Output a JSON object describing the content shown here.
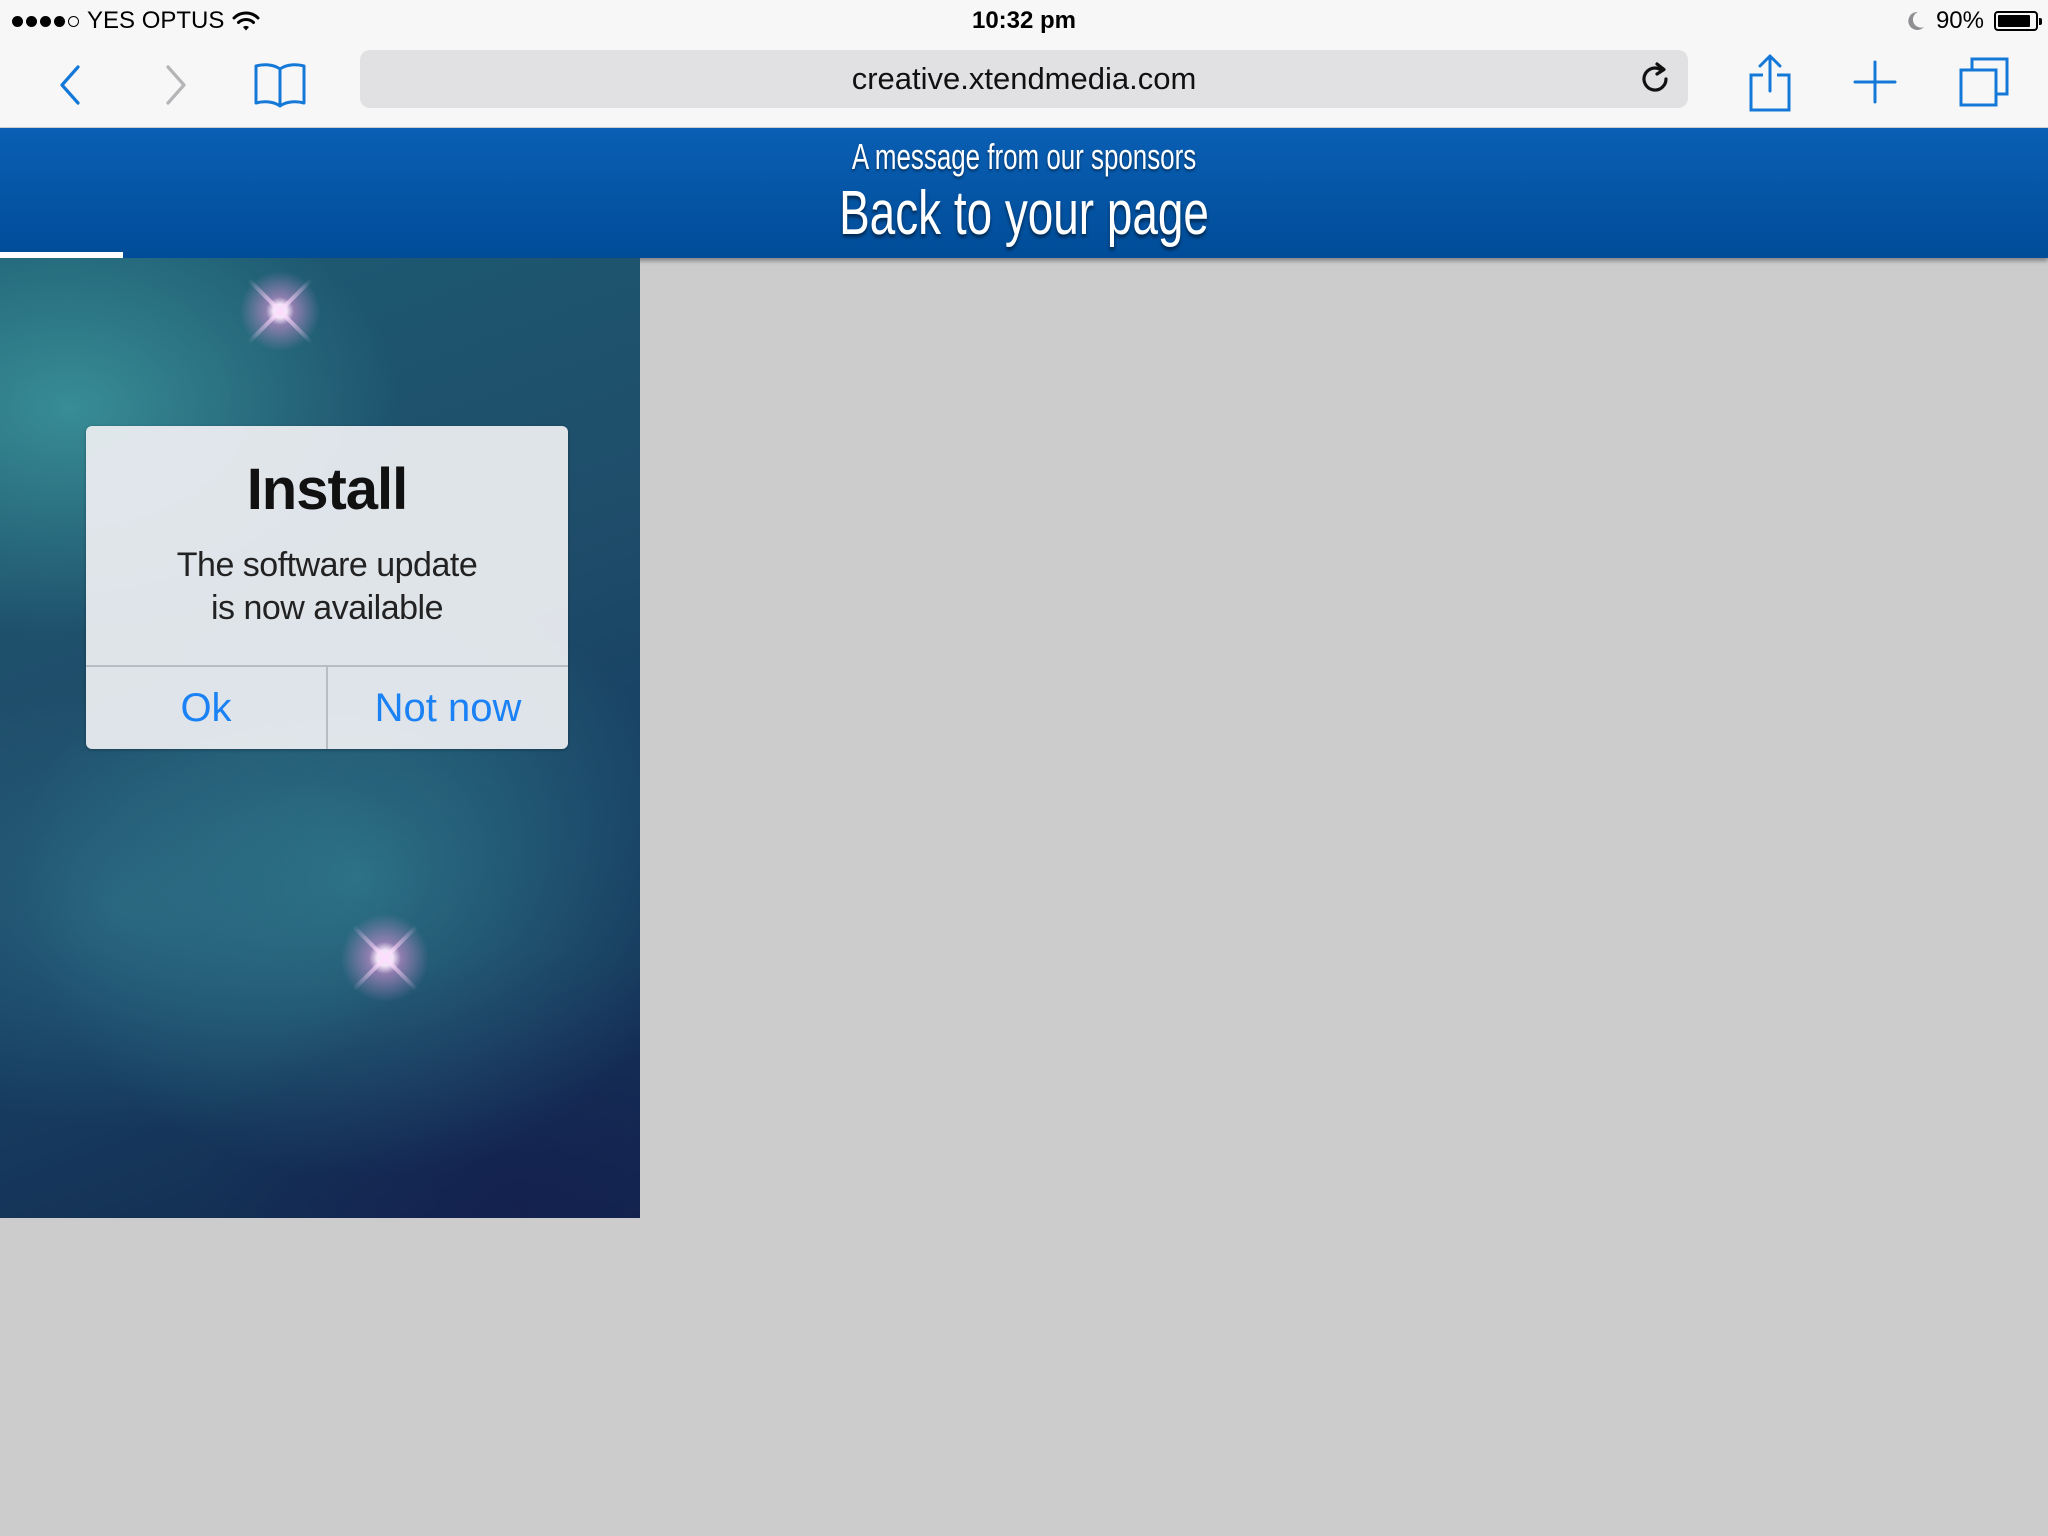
{
  "status_bar": {
    "carrier": "YES OPTUS",
    "time": "10:32 pm",
    "battery_percent": "90%",
    "battery_level": 0.9,
    "signal_bars_filled": 4,
    "signal_bars_total": 5
  },
  "toolbar": {
    "back_icon": "chevron-left-icon",
    "forward_icon": "chevron-right-icon",
    "bookmarks_icon": "open-book-icon",
    "address": "creative.xtendmedia.com",
    "reload_icon": "reload-icon",
    "share_icon": "share-icon",
    "new_tab_icon": "plus-icon",
    "tabs_icon": "tabs-icon"
  },
  "banner": {
    "subtitle": "A message from our sponsors",
    "title": "Back to your page",
    "load_progress": 0.06
  },
  "ad": {
    "dialog": {
      "title": "Install",
      "message_line1": "The software update",
      "message_line2": "is now available",
      "ok_label": "Ok",
      "not_now_label": "Not now"
    }
  },
  "colors": {
    "accent": "#1a82f5",
    "toolbar_icon": "#1478d9",
    "banner_blue": "#0055a5",
    "page_background": "#cccccc",
    "chrome_background": "#f7f7f7"
  }
}
